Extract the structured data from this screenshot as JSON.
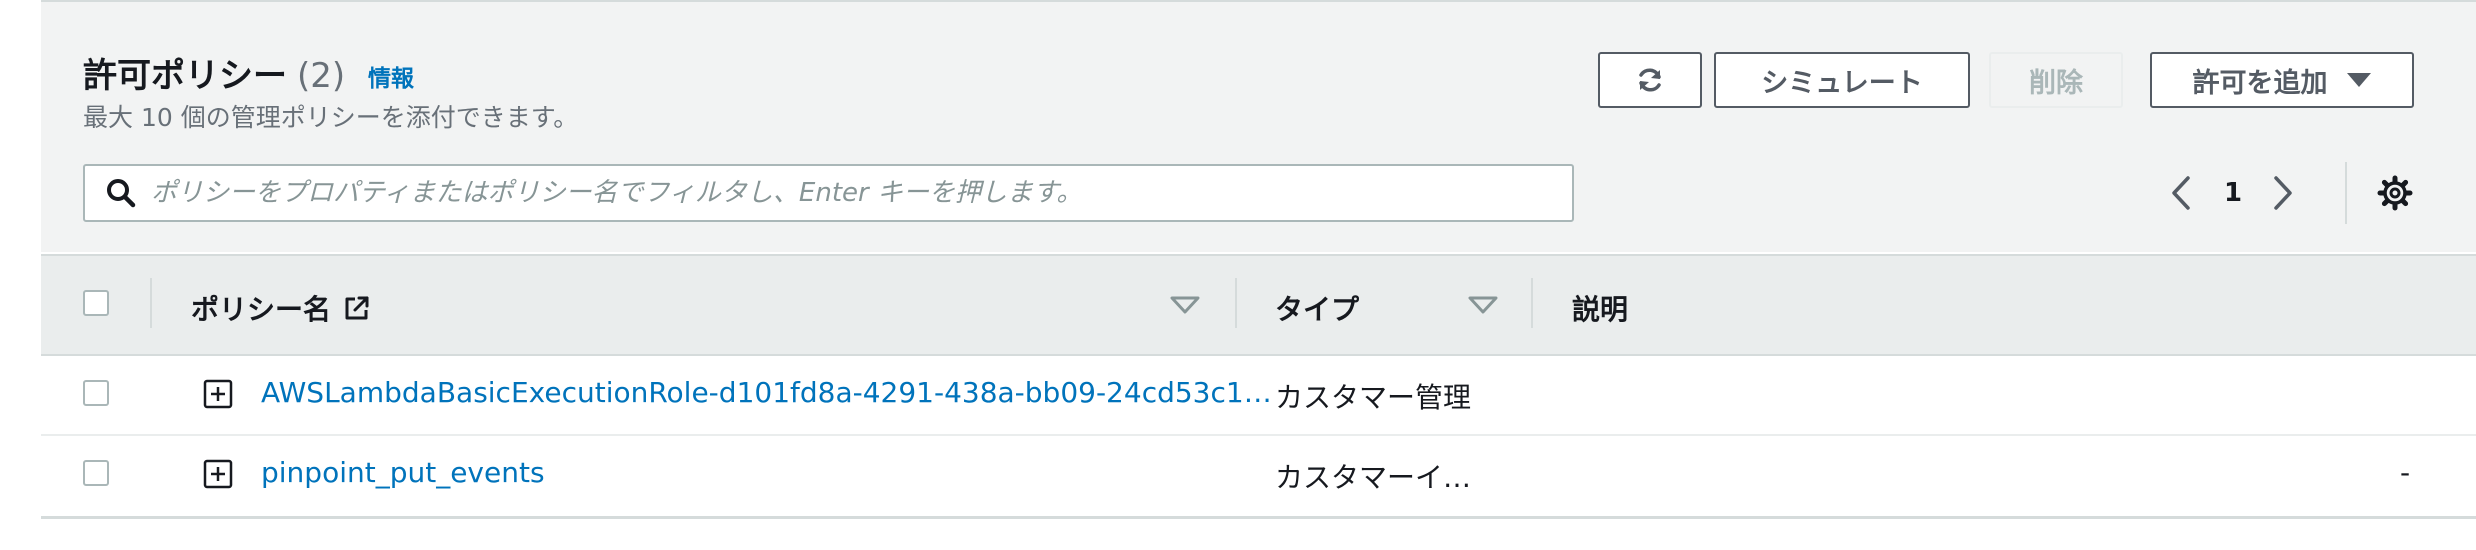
{
  "section": {
    "title": "許可ポリシー",
    "count": "(2)",
    "info_link": "情報",
    "description": "最大 10 個の管理ポリシーを添付できます。"
  },
  "toolbar": {
    "refresh_icon": "refresh-icon",
    "simulate_label": "シミュレート",
    "delete_label": "削除",
    "add_permission_label": "許可を追加",
    "dropdown_icon": "caret-down-icon"
  },
  "search": {
    "placeholder": "ポリシーをプロパティまたはポリシー名でフィルタし、Enter キーを押します。",
    "value": ""
  },
  "pagination": {
    "current_page": "1"
  },
  "table": {
    "headers": {
      "policy_name": "ポリシー名",
      "type": "タイプ",
      "description": "説明"
    },
    "rows": [
      {
        "name": "AWSLambdaBasicExecutionRole-d101fd8a-4291-438a-bb09-24cd53c1…",
        "type": "カスタマー管理",
        "description": ""
      },
      {
        "name": "pinpoint_put_events",
        "type": "カスタマーイ…",
        "description": "-"
      }
    ]
  },
  "colors": {
    "link": "#0073bb",
    "header_bg": "#f2f3f3",
    "table_header_bg": "#eaeded",
    "border": "#aab7b8"
  }
}
